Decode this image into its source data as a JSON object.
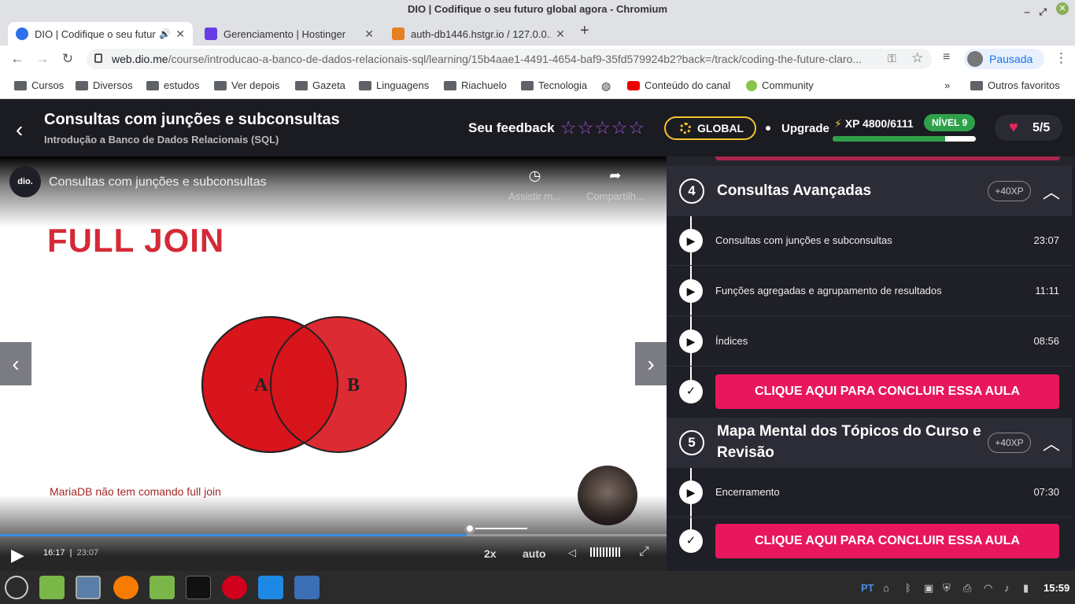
{
  "window": {
    "title": "DIO | Codifique o seu futuro global agora - Chromium"
  },
  "tabs": [
    {
      "title": "DIO | Codifique o seu futuro global agora",
      "icon": "dio-favicon-icon",
      "active": true,
      "audio": "🔊"
    },
    {
      "title": "Gerenciamento | Hostinger",
      "icon": "hostinger-favicon-icon"
    },
    {
      "title": "auth-db1446.hstgr.io / 127.0.0.1",
      "icon": "phpmyadmin-favicon-icon"
    }
  ],
  "omnibox": {
    "host": "web.dio.me",
    "path": "/course/introducao-a-banco-de-dados-relacionais-sql/learning/15b4aae1-4491-4654-baf9-35fd579924b2?back=/track/coding-the-future-claro..."
  },
  "profile": {
    "label": "Pausada"
  },
  "bookmarks": [
    "Cursos",
    "Diversos",
    "estudos",
    "Ver depois",
    "Gazeta",
    "Linguagens",
    "Riachuelo",
    "Tecnologia",
    "",
    "Conteúdo do canal",
    "Community"
  ],
  "bookmarks_more": "»",
  "bookmarks_other": "Outros favoritos",
  "header": {
    "course_title": "Consultas com junções e subconsultas",
    "course_subtitle": "Introdução a Banco de Dados Relacionais (SQL)",
    "feedback_label": "Seu feedback",
    "stars": "☆☆☆☆☆",
    "global_label": "GLOBAL",
    "upgrade_label": "Upgrade",
    "xp_text": "XP 4800/6111",
    "xp_fraction": 0.786,
    "level_label": "NÍVEL 9",
    "lives": "5/5"
  },
  "video": {
    "channel_logo": "dio.",
    "title": "Consultas com junções e subconsultas",
    "watch_later": "Assistir m...",
    "share": "Compartilh...",
    "slide_title": "FULL JOIN",
    "venn_labels": [
      "A",
      "B"
    ],
    "caption": "MariaDB não tem comando full join",
    "current_time": "16:17",
    "duration": "23:07",
    "progress_fraction": 0.7,
    "speed": "2x",
    "quality": "auto"
  },
  "sidebar": {
    "modules": [
      {
        "number": "4",
        "title": "Consultas Avançadas",
        "xp": "+40XP",
        "lessons": [
          {
            "title": "Consultas com junções e subconsultas",
            "duration": "23:07"
          },
          {
            "title": "Funções agregadas e agrupamento de resultados",
            "duration": "11:11"
          },
          {
            "title": "Índices",
            "duration": "08:56"
          }
        ],
        "complete_button": "CLIQUE AQUI PARA CONCLUIR ESSA AULA"
      },
      {
        "number": "5",
        "title": "Mapa Mental dos Tópicos do Curso e Revisão",
        "xp": "+40XP",
        "lessons": [
          {
            "title": "Encerramento",
            "duration": "07:30"
          }
        ],
        "complete_button": "CLIQUE AQUI PARA CONCLUIR ESSA AULA"
      }
    ]
  },
  "taskbar": {
    "lang": "PT",
    "clock": "15:59"
  },
  "colors": {
    "accent_pink": "#e8175d",
    "level_green": "#2ea04a",
    "global_yellow": "#f4c430",
    "star_purple": "#9b59d0"
  }
}
